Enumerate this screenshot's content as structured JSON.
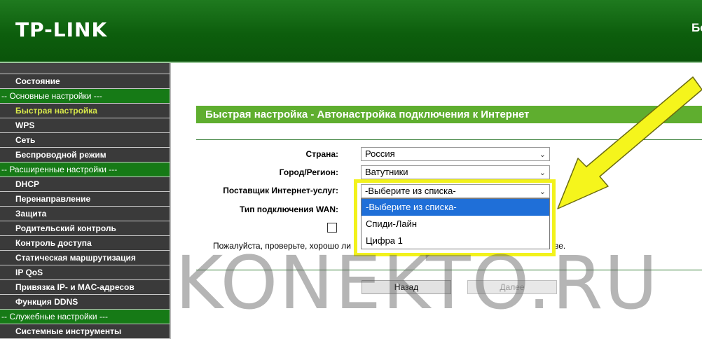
{
  "header": {
    "logo": "TP-LINK",
    "right_text": "Бе"
  },
  "sidebar": {
    "items": [
      {
        "label": "Состояние",
        "type": "item"
      },
      {
        "label": "-- Основные настройки ---",
        "type": "group"
      },
      {
        "label": "Быстрая настройка",
        "type": "item",
        "active": true
      },
      {
        "label": "WPS",
        "type": "item"
      },
      {
        "label": "Сеть",
        "type": "item"
      },
      {
        "label": "Беспроводной режим",
        "type": "item"
      },
      {
        "label": "-- Расширенные настройки ---",
        "type": "group"
      },
      {
        "label": "DHCP",
        "type": "item"
      },
      {
        "label": "Перенаправление",
        "type": "item"
      },
      {
        "label": "Защита",
        "type": "item"
      },
      {
        "label": "Родительский контроль",
        "type": "item"
      },
      {
        "label": "Контроль доступа",
        "type": "item"
      },
      {
        "label": "Статическая маршрутизация",
        "type": "item"
      },
      {
        "label": "IP QoS",
        "type": "item"
      },
      {
        "label": "Привязка IP- и MAC-адресов",
        "type": "item"
      },
      {
        "label": "Функция DDNS",
        "type": "item"
      },
      {
        "label": "-- Служебные настройки ---",
        "type": "group"
      },
      {
        "label": "Системные инструменты",
        "type": "item"
      }
    ]
  },
  "main": {
    "title": "Быстрая настройка - Автонастройка подключения к Интернет",
    "country_label": "Страна:",
    "country_value": "Россия",
    "city_label": "Город/Регион:",
    "city_value": "Ватутники",
    "isp_label": "Поставщик Интернет-услуг:",
    "isp_value": "-Выберите из списка-",
    "wan_label": "Тип подключения WAN:",
    "isp_options": [
      "-Выберите из списка-",
      "Спиди-Лайн",
      "Цифра 1"
    ],
    "notice_left": "Пожалуйста, проверьте, хорошо ли",
    "notice_right": "ве.",
    "back_button": "Назад",
    "next_button": "Далее"
  },
  "watermark": "KONEKTO.RU",
  "colors": {
    "header_green": "#0d5e0d",
    "title_bar": "#5fae2f",
    "group_green": "#167a16",
    "menu_dark": "#3a3a3a",
    "active_item": "#d7e84a",
    "selected_option": "#1f6fd8",
    "highlight_yellow": "#f2f21c"
  }
}
